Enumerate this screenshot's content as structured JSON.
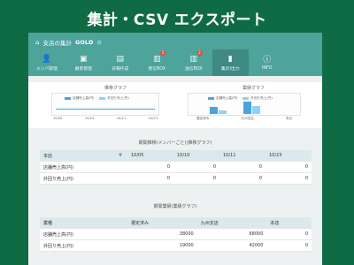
{
  "headline": "集計・CSV エクスポート",
  "breadcrumb": {
    "label": "支店の集計",
    "shop": "GOLD"
  },
  "nav": [
    {
      "label": "メンバ管理",
      "icon": "person-add-icon",
      "glyph": "👤"
    },
    {
      "label": "顧客管理",
      "icon": "folder-icon",
      "glyph": "▣"
    },
    {
      "label": "日報作成",
      "icon": "document-icon",
      "glyph": "▤"
    },
    {
      "label": "受信BOX",
      "icon": "inbox-icon",
      "glyph": "▥",
      "badge": "5"
    },
    {
      "label": "送信BOX",
      "icon": "outbox-icon",
      "glyph": "▥",
      "badge": "2"
    },
    {
      "label": "集計/出力",
      "icon": "bar-chart-icon",
      "glyph": "▮",
      "active": true
    },
    {
      "label": "INFO",
      "icon": "info-icon",
      "glyph": "ⓘ"
    }
  ],
  "trend": {
    "title": "推移グラフ",
    "legend": [
      "店舗売上高(円)",
      "外回り売上(円)"
    ],
    "ticks": [
      "10/05",
      "10/10",
      "10/11",
      "10/23"
    ]
  },
  "compare": {
    "title": "業績グラフ",
    "legend": [
      "店舗売上高(円)",
      "外回り売上(円)"
    ],
    "ticks": [
      "選定済み",
      "九州支店",
      "本店"
    ]
  },
  "period_section": "期間推移(メンバーごと)(推移グラフ)",
  "period_table": {
    "selector": "本店",
    "dates": [
      "10/05",
      "10/10",
      "10/11",
      "10/23"
    ],
    "rows": [
      {
        "label": "店舗売上高(円)",
        "values": [
          "0",
          "0",
          "0",
          "0"
        ]
      },
      {
        "label": "外回り売上(円)",
        "values": [
          "0",
          "0",
          "0",
          "0"
        ]
      }
    ]
  },
  "perf_section": "期間業績(業績グラフ)",
  "perf_table": {
    "headers": [
      "業種",
      "選定済み",
      "九州支店",
      "本店"
    ],
    "rows": [
      {
        "label": "店舗売上高(円)",
        "values": [
          "38000",
          "68000",
          "0"
        ]
      },
      {
        "label": "外回り売上(円)",
        "values": [
          "19000",
          "42000",
          "0"
        ]
      }
    ]
  },
  "colors": {
    "background": "#0f6b44",
    "topbar": "#4ea39b",
    "series_store": "#4aa3df",
    "series_outside": "#8fd3f4"
  }
}
